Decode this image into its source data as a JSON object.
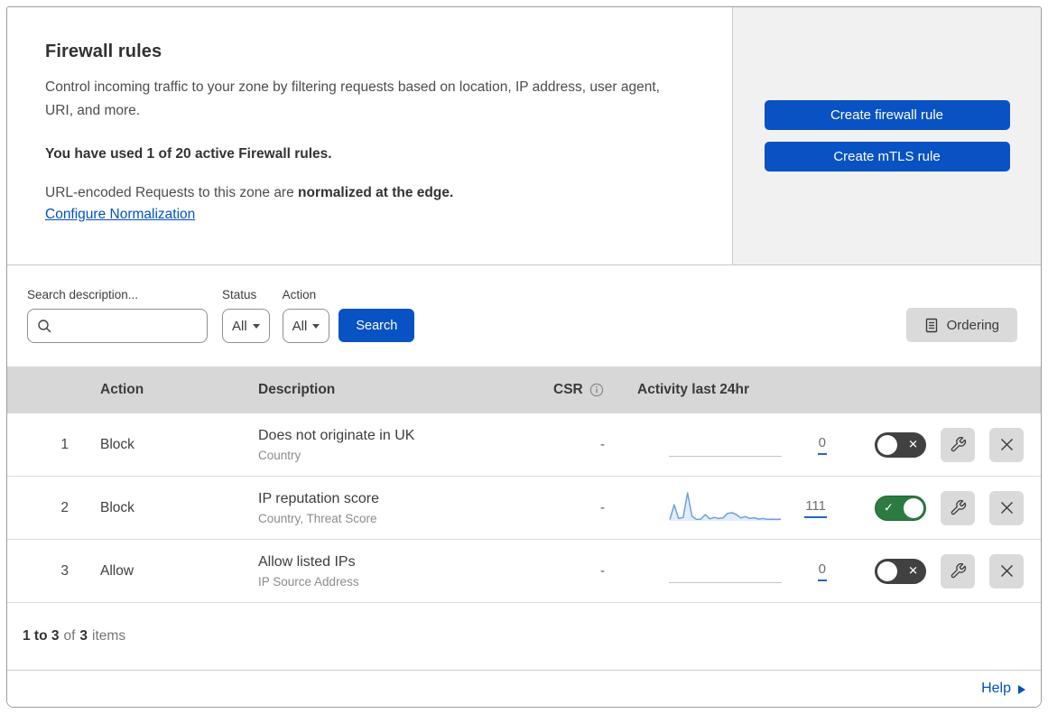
{
  "hero": {
    "title": "Firewall rules",
    "description": "Control incoming traffic to your zone by filtering requests based on location, IP address, user agent, URI, and more.",
    "usage": "You have used 1 of 20 active Firewall rules.",
    "normalization_prefix": "URL-encoded Requests to this zone are ",
    "normalization_bold": "normalized at the edge.",
    "normalization_link": "Configure Normalization",
    "create_firewall_button": "Create firewall rule",
    "create_mtls_button": "Create mTLS rule"
  },
  "filters": {
    "search_label": "Search description...",
    "search_value": "",
    "status_label": "Status",
    "status_value": "All",
    "action_label": "Action",
    "action_value": "All",
    "search_button": "Search",
    "ordering_button": "Ordering"
  },
  "table": {
    "headers": {
      "action": "Action",
      "description": "Description",
      "csr": "CSR",
      "activity": "Activity last 24hr"
    },
    "rows": [
      {
        "num": "1",
        "action": "Block",
        "description": "Does not originate in UK",
        "fields": "Country",
        "csr": "-",
        "count": "0",
        "enabled": false,
        "sparkline_values": []
      },
      {
        "num": "2",
        "action": "Block",
        "description": "IP reputation score",
        "fields": "Country, Threat Score",
        "csr": "-",
        "count": "111",
        "enabled": true,
        "sparkline_values": [
          4,
          55,
          8,
          12,
          97,
          16,
          5,
          6,
          22,
          7,
          12,
          8,
          10,
          26,
          28,
          22,
          10,
          15,
          8,
          11,
          6,
          8,
          5,
          6,
          5,
          6
        ]
      },
      {
        "num": "3",
        "action": "Allow",
        "description": "Allow listed IPs",
        "fields": "IP Source Address",
        "csr": "-",
        "count": "0",
        "enabled": false,
        "sparkline_values": []
      }
    ]
  },
  "footer": {
    "range": "1 to 3",
    "of": "of",
    "total": "3",
    "items": "items",
    "help": "Help"
  },
  "toggles": {
    "on_glyph": "✓",
    "off_glyph": "✕"
  },
  "colors": {
    "primary_blue": "#0952c4",
    "link_blue": "#0051c3",
    "toggle_on_green": "#2c7b42",
    "toggle_off_gray": "#414141",
    "header_gray": "#d7d7d7",
    "panel_gray": "#f1f1f1",
    "sparkline_stroke": "#6f9fe0",
    "sparkline_fill": "#e3edfa"
  }
}
